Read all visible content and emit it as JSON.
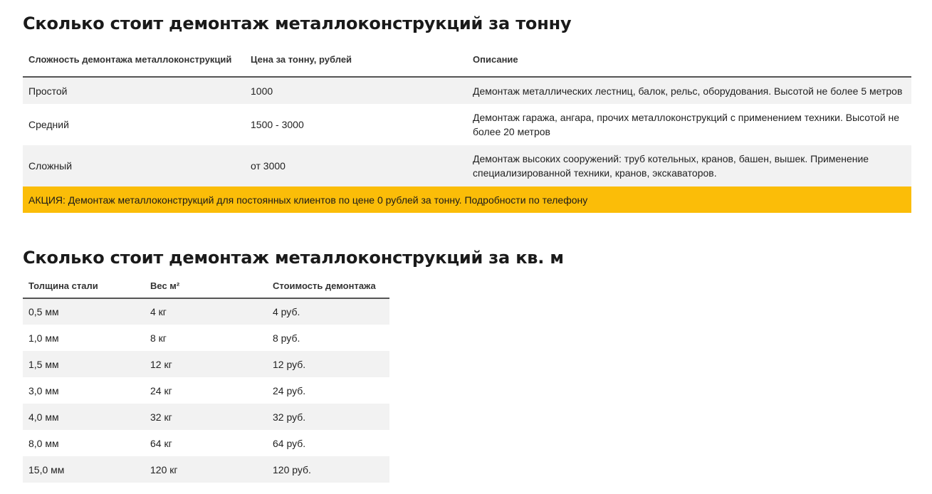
{
  "section1": {
    "title": "Сколько стоит демонтаж металлоконструкций за тонну",
    "headers": [
      "Сложность демонтажа металлоконструкций",
      "Цена за тонну, рублей",
      "Описание"
    ],
    "rows": [
      [
        "Простой",
        "1000",
        "Демонтаж металлических лестниц, балок, рельс, оборудования. Высотой не более 5 метров"
      ],
      [
        "Средний",
        "1500 - 3000",
        "Демонтаж гаража, ангара, прочих металлоконструкций с применением техники. Высотой не более 20 метров"
      ],
      [
        "Сложный",
        "от 3000",
        "Демонтаж высоких сооружений: труб котельных, кранов, башен, вышек. Применение специализированной техники, кранов, экскаваторов."
      ]
    ],
    "promo": "АКЦИЯ: Демонтаж металлоконструкций для постоянных клиентов по цене 0 рублей за тонну. Подробности по телефону",
    "promo_color": "#fbbd08"
  },
  "section2": {
    "title": "Сколько стоит демонтаж металлоконструкций за кв. м",
    "headers": [
      "Толщина стали",
      "Вес м²",
      "Стоимость демонтажа"
    ],
    "rows": [
      [
        "0,5 мм",
        "4 кг",
        "4 руб."
      ],
      [
        "1,0 мм",
        "8 кг",
        "8 руб."
      ],
      [
        "1,5 мм",
        "12 кг",
        "12 руб."
      ],
      [
        "3,0 мм",
        "24 кг",
        "24 руб."
      ],
      [
        "4,0 мм",
        "32 кг",
        "32 руб."
      ],
      [
        "8,0 мм",
        "64 кг",
        "64 руб."
      ],
      [
        "15,0 мм",
        "120 кг",
        "120 руб."
      ]
    ]
  }
}
